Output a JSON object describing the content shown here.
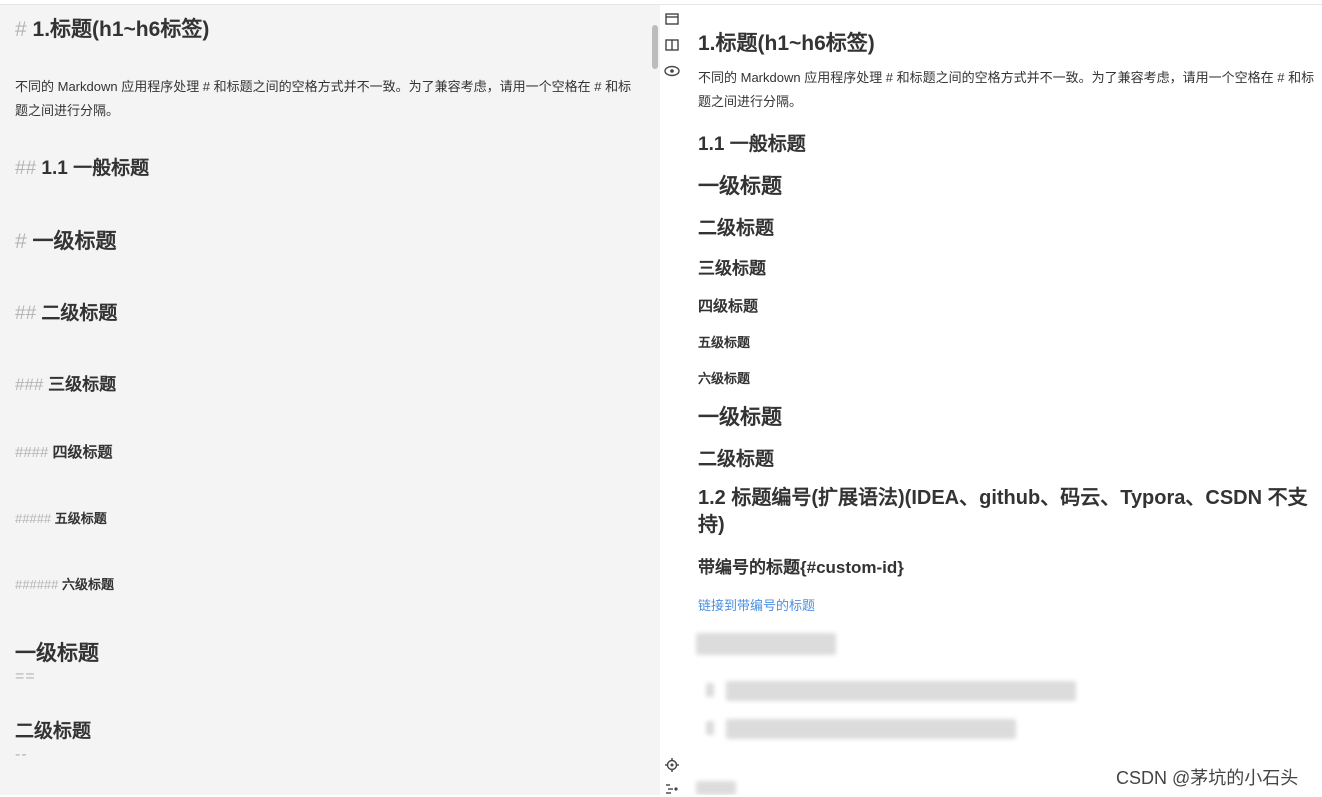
{
  "editor": {
    "h1": {
      "marker": "#",
      "text": "1.标题(h1~h6标签)"
    },
    "intro": "不同的 Markdown 应用程序处理 # 和标题之间的空格方式并不一致。为了兼容考虑，请用一个空格在 # 和标题之间进行分隔。",
    "h2_general": {
      "marker": "##",
      "text": "1.1 一般标题"
    },
    "l1": {
      "marker": "#",
      "text": "一级标题"
    },
    "l2": {
      "marker": "##",
      "text": "二级标题"
    },
    "l3": {
      "marker": "###",
      "text": "三级标题"
    },
    "l4": {
      "marker": "####",
      "text": "四级标题"
    },
    "l5": {
      "marker": "#####",
      "text": "五级标题"
    },
    "l6": {
      "marker": "######",
      "text": "六级标题"
    },
    "setext1": {
      "text": "一级标题",
      "underline": "=="
    },
    "setext2": {
      "text": "二级标题",
      "underline": "--"
    }
  },
  "preview": {
    "h1": "1.标题(h1~h6标签)",
    "intro": "不同的 Markdown 应用程序处理 # 和标题之间的空格方式并不一致。为了兼容考虑，请用一个空格在 # 和标题之间进行分隔。",
    "general": "1.1 一般标题",
    "l1": "一级标题",
    "l2": "二级标题",
    "l3": "三级标题",
    "l4": "四级标题",
    "l5": "五级标题",
    "l6": "六级标题",
    "setext1": "一级标题",
    "setext2": "二级标题",
    "numbered_heading": "1.2 标题编号(扩展语法)(IDEA、github、码云、Typora、CSDN 不支持)",
    "custom_id_heading": "带编号的标题{#custom-id}",
    "link": "链接到带编号的标题"
  },
  "toolbar": {
    "icons": [
      "layout-top-icon",
      "split-view-icon",
      "preview-eye-icon",
      "locate-icon",
      "outline-icon"
    ]
  },
  "watermark": "CSDN @茅坑的小石头"
}
